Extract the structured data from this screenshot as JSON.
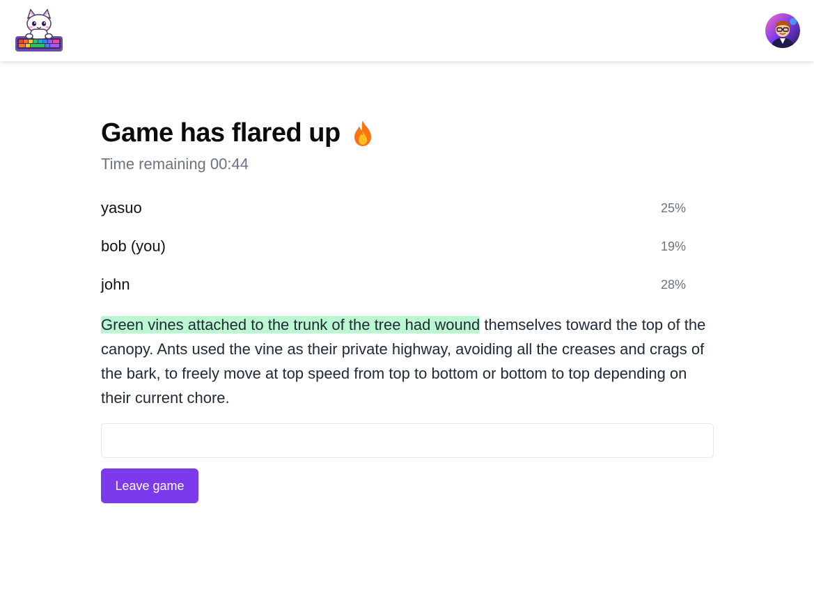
{
  "header": {
    "logo_icon": "cat-keyboard-logo-icon",
    "avatar_icon": "user-avatar-icon"
  },
  "game": {
    "title": "Game has flared up",
    "title_icon": "fire-icon",
    "timer_text": "Time remaining 00:44"
  },
  "players": [
    {
      "name": "yasuo",
      "progress": "25%"
    },
    {
      "name": "bob (you)",
      "progress": "19%"
    },
    {
      "name": "john",
      "progress": "28%"
    }
  ],
  "passage": {
    "typed": "Green vines attached to the trunk of the tree had wound",
    "remaining": " themselves toward the top of the canopy. Ants used the vine as their private highway, avoiding all the creases and crags of the bark, to freely move at top speed from top to bottom or bottom to top depending on their current chore."
  },
  "input": {
    "value": "",
    "placeholder": ""
  },
  "actions": {
    "leave_label": "Leave game"
  },
  "colors": {
    "accent": "#7c3aed",
    "typed_highlight": "#bbf7d0",
    "muted_text": "#6b7280"
  }
}
